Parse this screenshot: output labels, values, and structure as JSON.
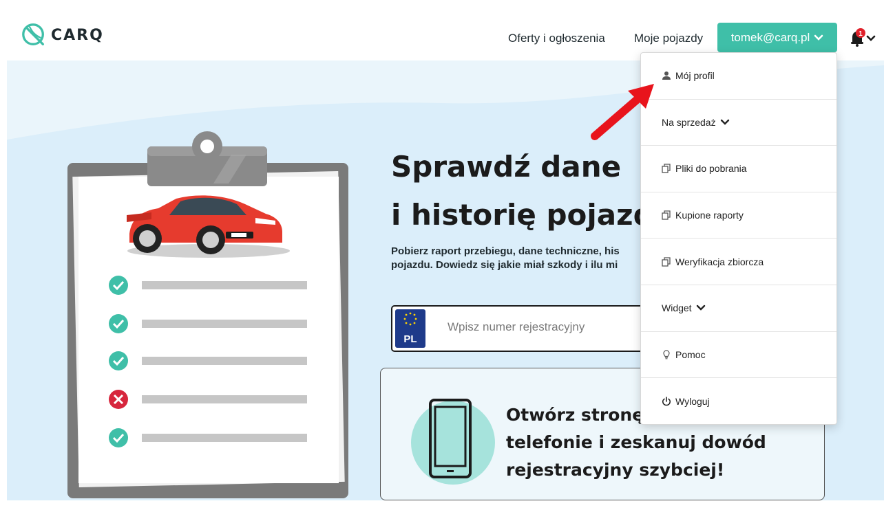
{
  "brand": {
    "name": "CARQ"
  },
  "nav": {
    "offers": "Oferty i ogłoszenia",
    "vehicles": "Moje pojazdy",
    "user_email": "tomek@carq.pl",
    "notification_count": "1"
  },
  "dropdown": {
    "items": [
      {
        "label": "Mój profil",
        "icon": "user-icon"
      },
      {
        "label": "Na sprzedaż",
        "icon": "chevron-down-icon"
      },
      {
        "label": "Pliki do pobrania",
        "icon": "copy-icon"
      },
      {
        "label": "Kupione raporty",
        "icon": "copy-icon"
      },
      {
        "label": "Weryfikacja zbiorcza",
        "icon": "copy-icon"
      },
      {
        "label": "Widget",
        "icon": "chevron-down-icon"
      },
      {
        "label": "Pomoc",
        "icon": "lightbulb-icon"
      },
      {
        "label": "Wyloguj",
        "icon": "power-icon"
      }
    ]
  },
  "hero": {
    "title_line1": "Sprawdź dane",
    "title_line2": "i historię pojazdu",
    "desc_line1": "Pobierz raport przebiegu, dane techniczne, his",
    "desc_line2": "pojazdu. Dowiedz się jakie miał szkody i ilu mi"
  },
  "plate": {
    "country": "PL",
    "placeholder": "Wpisz numer rejestracyjny"
  },
  "promo": {
    "line1": "Otwórz stronę o",
    "line2": "telefonie i zeskanuj dowód",
    "line3": "rejestracyjny szybciej!"
  },
  "checklist": {
    "items": [
      "ok",
      "ok",
      "ok",
      "fail",
      "ok"
    ]
  },
  "colors": {
    "accent": "#3fbfa8",
    "background_wave": "#e3f1fa",
    "badge": "#e0202a",
    "fail": "#d7263d",
    "arrow": "#e8141c"
  }
}
